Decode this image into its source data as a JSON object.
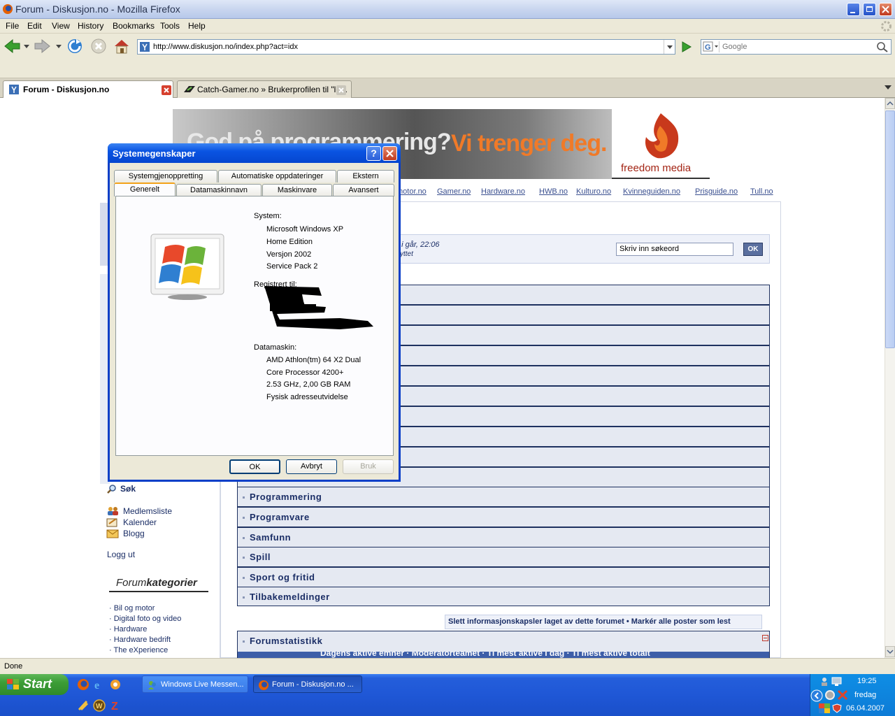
{
  "window": {
    "title": "Forum - Diskusjon.no - Mozilla Firefox"
  },
  "menu": [
    "File",
    "Edit",
    "View",
    "History",
    "Bookmarks",
    "Tools",
    "Help"
  ],
  "navigation": {
    "url": "http://www.diskusjon.no/index.php?act=idx",
    "search_placeholder": "Google"
  },
  "tabs": [
    {
      "label": "Forum - Diskusjon.no",
      "active": true
    },
    {
      "label": "Catch-Gamer.no » Brukerprofilen til \"le...",
      "active": false
    }
  ],
  "status": "Done",
  "page": {
    "banner_text_1": "God på programmering?",
    "banner_text_2": "Vi trenger deg.",
    "publisher": "freedom media",
    "sites": [
      "motor.no",
      "Gamer.no",
      "Hardware.no",
      "HWB.no",
      "Kulturo.no",
      "Kvinneguiden.no",
      "Prisguide.no",
      "Tull.no"
    ],
    "last_visit": ": i går, 22:06",
    "last_visit_sub": "yttet",
    "search_placeholder": "Skriv inn søkeord",
    "search_button": "OK",
    "forums": [
      "Programmering",
      "Programvare",
      "Samfunn",
      "Spill",
      "Sport og fritid",
      "Tilbakemeldinger"
    ],
    "side_links": {
      "search": "Søk",
      "members": "Medlemsliste",
      "calendar": "Kalender",
      "blog": "Blogg",
      "logout": "Logg ut"
    },
    "categories_title_1": "Forum",
    "categories_title_2": "kategorier",
    "categories": [
      "Bil og motor",
      "Digital foto og video",
      "Hardware",
      "Hardware bedrift",
      "The eXperience"
    ],
    "cookie_links": "Slett informasjonskapsler laget av dette forumet • Markér alle poster som lest",
    "stats_title": "Forumstatistikk",
    "stats_sub": "Dagens aktive emner · Moderatorteamet · Ti mest aktive i dag · Ti mest aktive totalt"
  },
  "dialog": {
    "title": "Systemegenskaper",
    "tabs_row1": [
      "Systemgjenoppretting",
      "Automatiske oppdateringer",
      "Ekstern"
    ],
    "tabs_row2": [
      "Generelt",
      "Datamaskinnavn",
      "Maskinvare",
      "Avansert"
    ],
    "system_label": "System:",
    "system": [
      "Microsoft Windows XP",
      "Home Edition",
      "Versjon 2002",
      "Service Pack 2"
    ],
    "registered_label": "Registrert til:",
    "computer_label": "Datamaskin:",
    "computer": [
      "AMD Athlon(tm) 64 X2 Dual",
      "Core Processor 4200+",
      "2.53 GHz, 2,00 GB RAM",
      "Fysisk adresseutvidelse"
    ],
    "buttons": {
      "ok": "OK",
      "cancel": "Avbryt",
      "apply": "Bruk"
    }
  },
  "taskbar": {
    "start": "Start",
    "tasks": [
      "Windows Live Messen...",
      "Forum - Diskusjon.no ..."
    ],
    "time": "19:25",
    "day": "fredag",
    "date": "06.04.2007"
  }
}
